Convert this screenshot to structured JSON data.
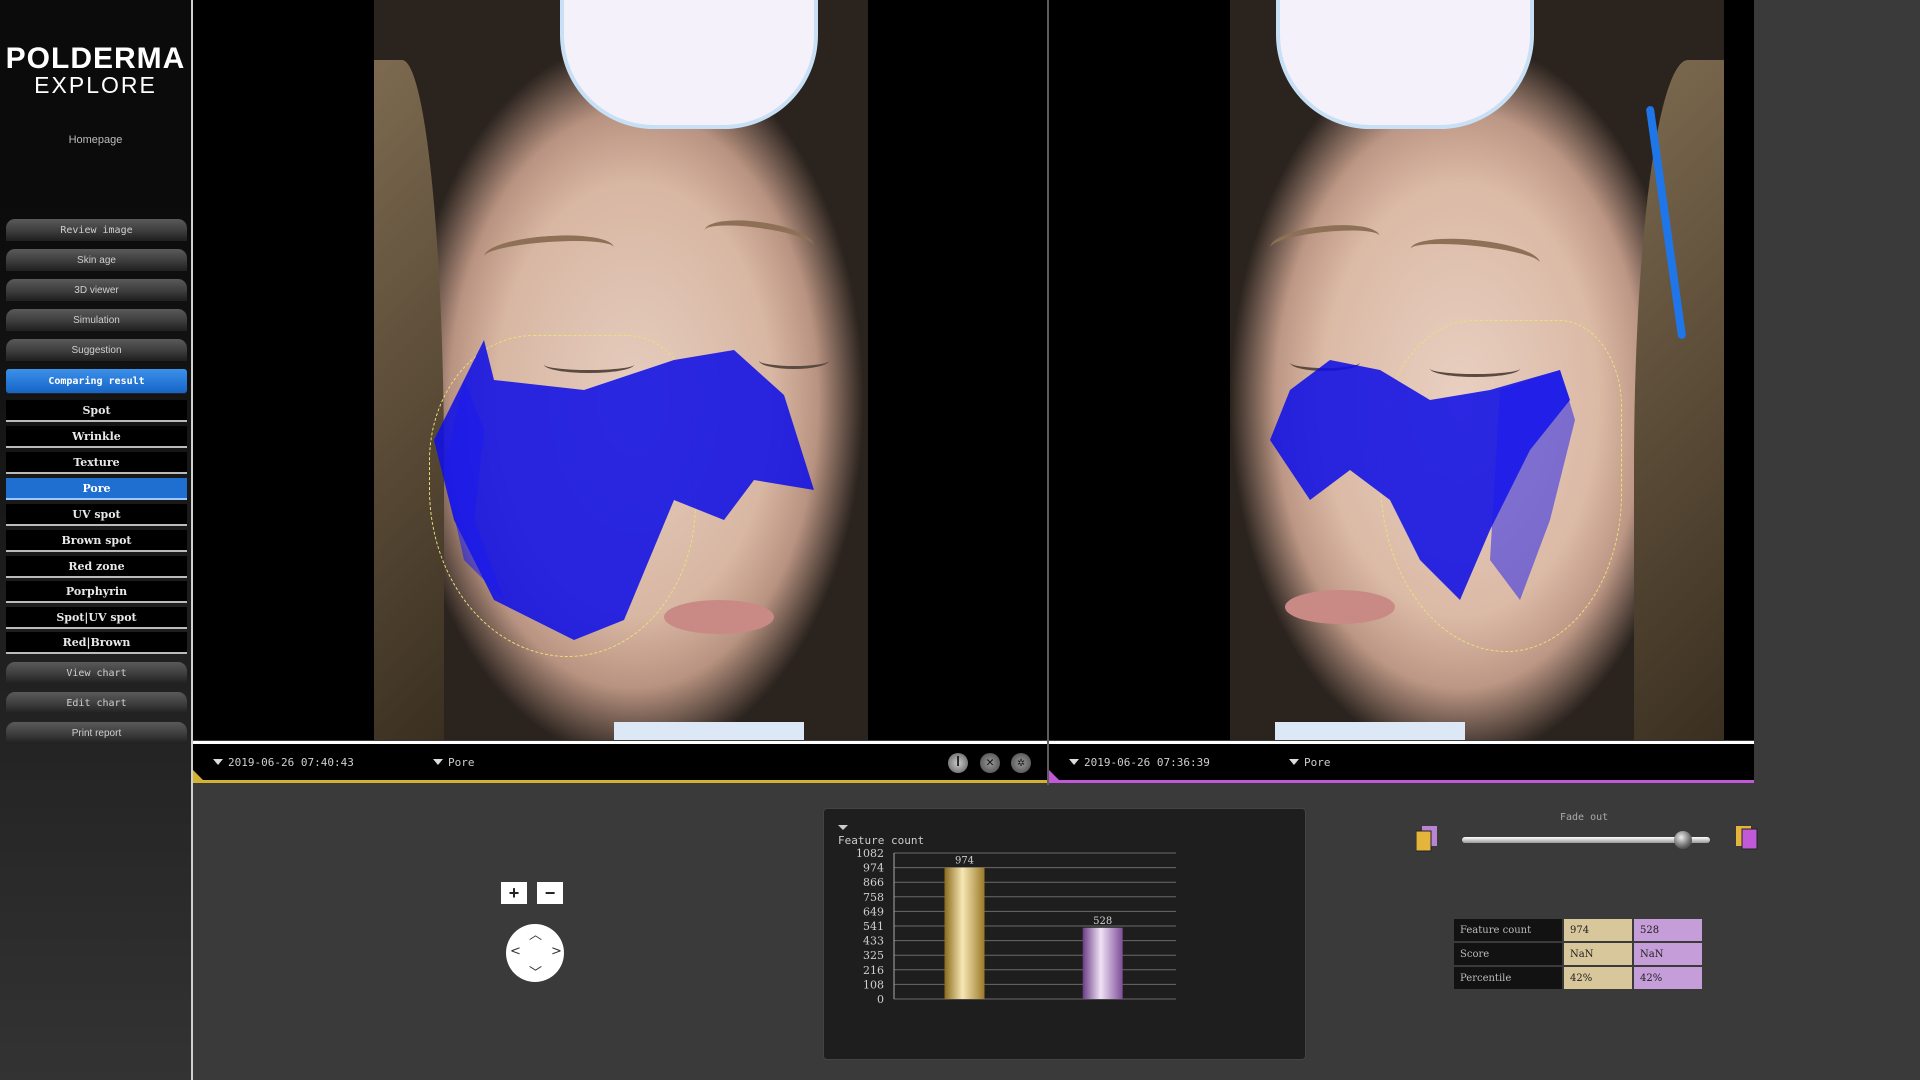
{
  "brand": {
    "line1": "POLDERMA",
    "line2": "EXPLORE"
  },
  "sidebar": {
    "homepage": "Homepage",
    "items": [
      {
        "label": "Review image"
      },
      {
        "label": "Skin age"
      },
      {
        "label": "3D viewer"
      },
      {
        "label": "Simulation"
      },
      {
        "label": "Suggestion"
      },
      {
        "label": "Comparing result",
        "active": true
      }
    ],
    "subitems": [
      {
        "label": "Spot"
      },
      {
        "label": "Wrinkle"
      },
      {
        "label": "Texture"
      },
      {
        "label": "Pore",
        "active": true
      },
      {
        "label": "UV spot"
      },
      {
        "label": "Brown spot"
      },
      {
        "label": "Red zone"
      },
      {
        "label": "Porphyrin"
      },
      {
        "label": "Spot|UV spot"
      },
      {
        "label": "Red|Brown"
      }
    ],
    "bottom_items": [
      {
        "label": "View chart"
      },
      {
        "label": "Edit chart"
      },
      {
        "label": "Print report"
      }
    ]
  },
  "left_image": {
    "date": "2019-06-26 07:40:43",
    "analysis": "Pore",
    "accent": "#d3b133"
  },
  "right_image": {
    "date": "2019-06-26 07:36:39",
    "analysis": "Pore",
    "accent": "#c058d8"
  },
  "controls": {
    "zoom_in": "+",
    "zoom_out": "−"
  },
  "fade": {
    "label": "Fade out",
    "value": 0.92
  },
  "chart_data": {
    "type": "bar",
    "title": "Feature count",
    "categories": [
      "2019-06-26 07:40:43",
      "2019-06-26 07:36:39"
    ],
    "values": [
      974,
      528
    ],
    "value_labels": [
      "974",
      "528"
    ],
    "colors": [
      "#d3b133",
      "#b484c8"
    ],
    "ylim": [
      0,
      1082
    ],
    "yticks": [
      "1082",
      "974",
      "866",
      "758",
      "649",
      "541",
      "433",
      "325",
      "216",
      "108",
      "0"
    ],
    "grid": true
  },
  "stats": {
    "rows": [
      {
        "label": "Feature count",
        "a": "974",
        "b": "528"
      },
      {
        "label": "Score",
        "a": "NaN",
        "b": "NaN"
      },
      {
        "label": "Percentile",
        "a": "42%",
        "b": "42%"
      }
    ]
  }
}
